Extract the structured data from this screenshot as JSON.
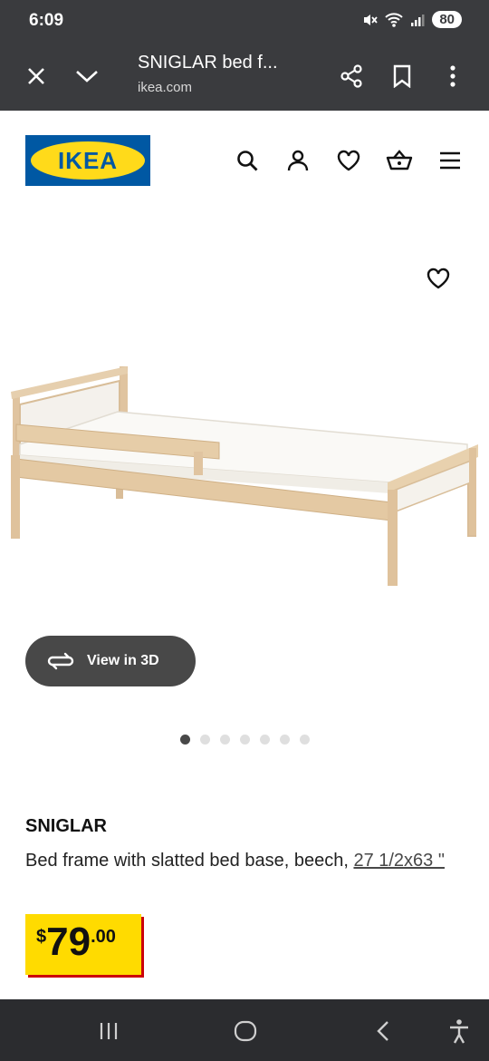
{
  "status_bar": {
    "time": "6:09",
    "battery": "80"
  },
  "browser": {
    "page_title": "SNIGLAR bed f...",
    "url": "ikea.com"
  },
  "header": {
    "logo_text": "IKEA"
  },
  "product": {
    "view_3d_label": "View in 3D",
    "image_count": 7,
    "active_image": 1,
    "name": "SNIGLAR",
    "description": "Bed frame with slatted bed base, beech, ",
    "size_link": "27 1/2x63 \"",
    "price": {
      "currency": "$",
      "integer": "79",
      "decimals": ".00"
    }
  },
  "colors": {
    "ikea_blue": "#0058a3",
    "ikea_yellow": "#ffda1a",
    "price_yellow": "#ffdb00",
    "price_red": "#cc0008"
  }
}
